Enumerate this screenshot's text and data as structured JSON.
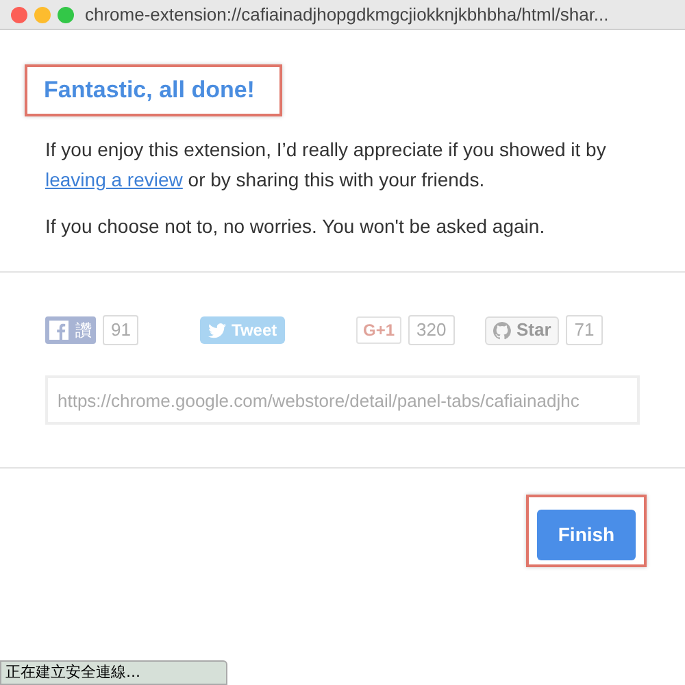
{
  "window": {
    "title": "chrome-extension://cafiainadjhopgdkmgcjiokknjkbhbha/html/shar..."
  },
  "heading": "Fantastic, all done!",
  "message": {
    "before": "If you enjoy this extension, I’d really appreciate if you showed it by ",
    "link": "leaving a review",
    "after": " or by sharing this with your friends."
  },
  "note": "If you choose not to, no worries. You won't be asked again.",
  "social": [
    {
      "kind": "facebook",
      "label": "讚",
      "count": "91"
    },
    {
      "kind": "twitter",
      "label": "Tweet"
    },
    {
      "kind": "gplus",
      "label": "G+1",
      "count": "320"
    },
    {
      "kind": "github",
      "label": "Star",
      "count": "71"
    }
  ],
  "share_url": {
    "value": "https://chrome.google.com/webstore/detail/panel-tabs/cafiainadjhc"
  },
  "finish_button": "Finish",
  "status_bar": "正在建立安全連線..."
}
